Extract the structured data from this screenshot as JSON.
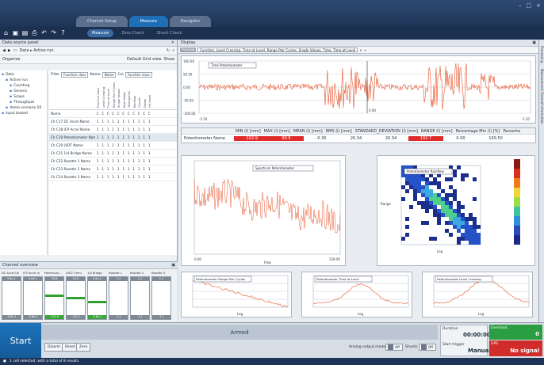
{
  "window": {
    "tabs": [
      "Channel Setup",
      "Measure",
      "Navigator"
    ],
    "active_tab": "Measure",
    "subtabs": [
      "Measure",
      "Zero Check",
      "Shunt Check"
    ],
    "active_subtab": "Measure"
  },
  "left_panel": {
    "header": "Data source panel",
    "breadcrumb": "Data ▸ Active run",
    "organize_label": "Organize",
    "default_grid_view": "Default Grid view",
    "show_label": "Show",
    "tree": [
      {
        "label": "Data",
        "level": 0
      },
      {
        "label": "Active run",
        "level": 1
      },
      {
        "label": "Counting",
        "level": 2
      },
      {
        "label": "Generic",
        "level": 2
      },
      {
        "label": "Scope",
        "level": 2
      },
      {
        "label": "Throughput",
        "level": 2
      },
      {
        "label": "demo scenario 02",
        "level": 1
      },
      {
        "label": "Input basket",
        "level": 0
      }
    ],
    "filter": {
      "label": "Filter",
      "value": "Function class",
      "name_label": "Name",
      "name_value": "Name",
      "col_label": "Col",
      "col_value": "Function class"
    },
    "column_headers": [
      "Function class",
      "Level Crossing",
      "Time at Level",
      "Range Pair Cycles",
      "Single Values",
      "Peak Valley",
      "Histograms",
      "Rainflow",
      "Counts",
      "Status",
      "Hit Level"
    ],
    "rows": [
      {
        "name": "Name",
        "cells": [
          "C",
          "C",
          "C",
          "C",
          "C",
          "C",
          "C",
          "C",
          "C",
          "C",
          "C"
        ]
      },
      {
        "name": "Ch C17 DC Accel Name",
        "cells": [
          "1",
          "1",
          "1",
          "1",
          "1",
          "1",
          "1",
          "1",
          "1",
          "1",
          "1"
        ]
      },
      {
        "name": "Ch C18 ICP Accel Name",
        "cells": [
          "1",
          "1",
          "1",
          "1",
          "1",
          "1",
          "1",
          "1",
          "1",
          "1",
          "1"
        ]
      },
      {
        "name": "Ch C19 Potentiometer Name",
        "cells": [
          "1",
          "1",
          "1",
          "1",
          "1",
          "1",
          "1",
          "1",
          "1",
          "1",
          "1"
        ]
      },
      {
        "name": "Ch C20 LVDT Name",
        "cells": [
          "1",
          "1",
          "1",
          "1",
          "1",
          "1",
          "1",
          "1",
          "1",
          "1",
          "1"
        ]
      },
      {
        "name": "Ch C21 1/4 Bridge Name",
        "cells": [
          "1",
          "1",
          "1",
          "1",
          "1",
          "1",
          "1",
          "1",
          "1",
          "1",
          "1"
        ]
      },
      {
        "name": "Ch C22 Rosette 1 Name",
        "cells": [
          "1",
          "1",
          "1",
          "1",
          "1",
          "1",
          "1",
          "1",
          "1",
          "1",
          "1"
        ]
      },
      {
        "name": "Ch C23 Rosette 2 Name",
        "cells": [
          "1",
          "1",
          "1",
          "1",
          "1",
          "1",
          "1",
          "1",
          "1",
          "1",
          "1"
        ]
      },
      {
        "name": "Ch C24 Rosette 3 Name",
        "cells": [
          "1",
          "1",
          "1",
          "1",
          "1",
          "1",
          "1",
          "1",
          "1",
          "1",
          "1"
        ]
      }
    ]
  },
  "channel_overview": {
    "title": "Channel overview",
    "channels": [
      {
        "label": "DC Accel Ue",
        "top": "9.8e-1",
        "bottom": "-9.8e-1",
        "level": null,
        "green": false
      },
      {
        "label": "ICP Accel m",
        "top": "9.8e-1",
        "bottom": "-9.8e-1",
        "level": null,
        "green": false
      },
      {
        "label": "Potentiom...",
        "top": "90.8",
        "bottom": "-102.9",
        "level": 0.38,
        "green": true
      },
      {
        "label": "LVDT (mm)",
        "top": "10.0",
        "bottom": "-10.0",
        "level": 0.45,
        "green": false
      },
      {
        "label": "1/4 Bridge",
        "top": "9.8e-1",
        "bottom": "-9.8e-1",
        "level": 0.55,
        "green": true
      },
      {
        "label": "Rosette 1",
        "top": "1.1",
        "bottom": "-1.1",
        "level": null,
        "green": false
      },
      {
        "label": "Rosette 2",
        "top": "1.1",
        "bottom": "-1.1",
        "level": null,
        "green": false
      },
      {
        "label": "Rosette 3",
        "top": "1.1",
        "bottom": "-1.1",
        "level": null,
        "green": false
      }
    ]
  },
  "display": {
    "header": "Display",
    "tabs": [
      "Preview",
      "Function, Level Crossing, Time at Level, Range Pair Cycles, Single Values, Time, Time at Level"
    ],
    "time_plot": {
      "legend": "Time Potentiometer",
      "y_ticks": [
        "100.00",
        "50.00",
        "0.00",
        "-50.00",
        "-100.00"
      ],
      "x_min": "-2.10",
      "x_max": "2.10",
      "cursor": "0.00"
    },
    "stats": {
      "columns": [
        "MIN (l) [mm]",
        "MAX (l) [mm]",
        "MEAN (l) [mm]",
        "RMS (l) [mm]",
        "STANDARD_DEVIATION (l) [mm]",
        "RANGE (l) [mm]",
        "Percentage Min (l) [%]",
        "Percenta"
      ],
      "row_name": "Potentiometer Name",
      "values": [
        "-102.9",
        "90.8",
        "-0.30",
        "20.34",
        "20.34",
        "193.7",
        "0.00",
        "100.50"
      ]
    },
    "spectrum_plot": {
      "legend": "Spectrum Potentiometer",
      "x_min": "0.00",
      "x_max": "128.00",
      "xlabel": "Freq"
    },
    "rainflow_plot": {
      "legend": "Potentiometer Rainflow",
      "xlabel": "Leg",
      "ylabel": "Range"
    },
    "small_plots": [
      {
        "legend": "Potentiometer Range Pair Cycles",
        "xlabel": "Leg"
      },
      {
        "legend": "Potentiometer Time at Level",
        "xlabel": "Leg"
      },
      {
        "legend": "Potentiometer Level Crossing",
        "xlabel": "Leg"
      }
    ],
    "side_rail": [
      "Processing",
      "Measurement Channel Information"
    ]
  },
  "bottom": {
    "start_label": "Start",
    "status_text": "Armed",
    "buttons": [
      "Disarm",
      "Reset",
      "Zero"
    ],
    "analog_output_label": "Analog output mode",
    "analog_output_state": "Off",
    "shunts_label": "Shunts",
    "shunts_state": "Off",
    "duration_label": "Duration",
    "duration_value": "00:00:00",
    "start_trigger_label": "Start trigger",
    "start_trigger_value": "Manual",
    "overload_label": "Overload",
    "overload_value": "0",
    "gps_label": "GPS",
    "gps_value": "No signal"
  },
  "statusbar": {
    "text": "1 cell selected, with a total of 8 results"
  },
  "colors": {
    "accent": "#1e6fb6",
    "signal": "#e8542a",
    "ok": "#2c9e42",
    "alarm": "#d02c2c"
  }
}
